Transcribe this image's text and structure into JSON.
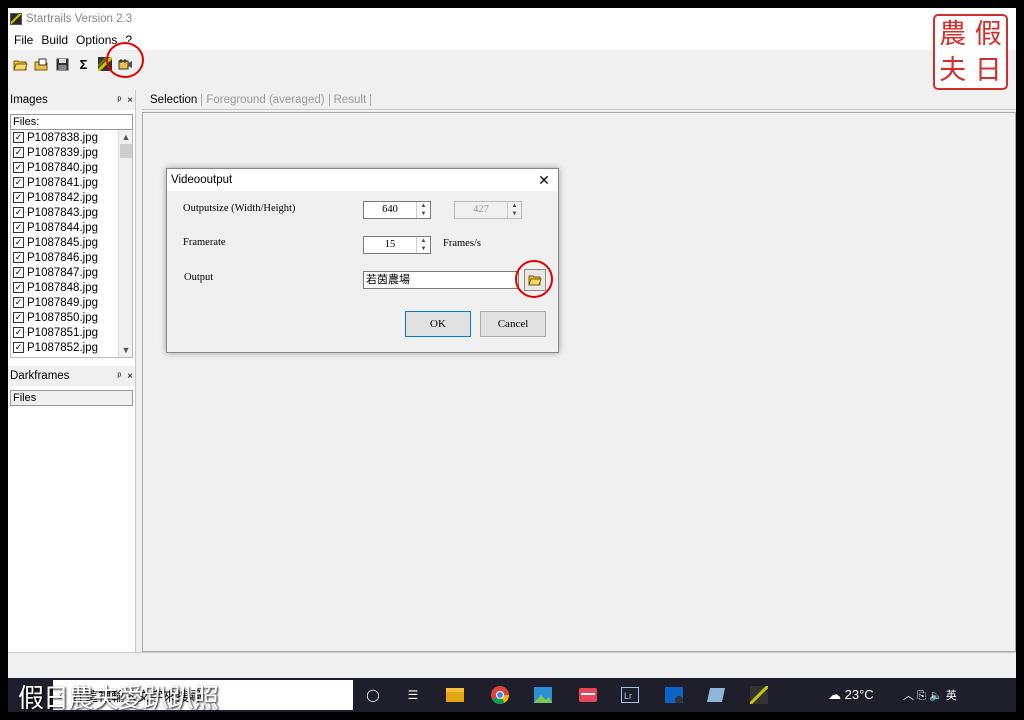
{
  "window": {
    "title": "Startrails Version 2.3"
  },
  "menu": [
    "File",
    "Build",
    "Options",
    "?"
  ],
  "toolbar": {
    "icons": [
      "open-folder-icon",
      "open-multiple-icon",
      "save-icon",
      "sigma-icon",
      "startrails-icon",
      "video-camera-icon"
    ],
    "sigma_glyph": "Σ"
  },
  "images_panel": {
    "title": "Images",
    "pin_glyph": "ᵖ",
    "close_glyph": "×",
    "files_header": "Files:",
    "files": [
      "P1087838.jpg",
      "P1087839.jpg",
      "P1087840.jpg",
      "P1087841.jpg",
      "P1087842.jpg",
      "P1087843.jpg",
      "P1087844.jpg",
      "P1087845.jpg",
      "P1087846.jpg",
      "P1087847.jpg",
      "P1087848.jpg",
      "P1087849.jpg",
      "P1087850.jpg",
      "P1087851.jpg",
      "P1087852.jpg"
    ]
  },
  "darkframes_panel": {
    "title": "Darkframes",
    "files_header": "Files"
  },
  "tabs": [
    "Selection",
    "Foreground (averaged)",
    "Result"
  ],
  "dialog": {
    "title": "Videooutput",
    "outputsize_label": "Outputsize (Width/Height)",
    "width": "640",
    "height": "427",
    "framerate_label": "Framerate",
    "framerate": "15",
    "framerate_unit": "Frames/s",
    "output_label": "Output",
    "output_value": "若茵農場",
    "ok_label": "OK",
    "cancel_label": "Cancel"
  },
  "taskbar": {
    "search_text": "在這裡輸入文字來搜尋",
    "watermark_text": "假日農夫愛趴趴照",
    "temperature": "23°C",
    "tray_text": "英"
  },
  "stamp": {
    "chars": [
      "農",
      "假",
      "夫",
      "日"
    ]
  },
  "colors": {
    "highlight": "#e00000",
    "stamp": "#d0302b"
  }
}
